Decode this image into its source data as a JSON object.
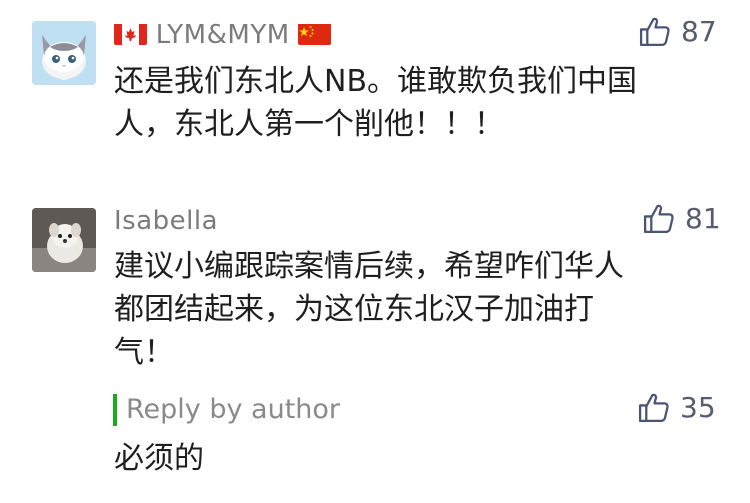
{
  "comments": [
    {
      "name": "LYM&MYM",
      "likes": "87",
      "text_lines": [
        "还是我们东北人NB。谁敢欺负我们中国",
        "人，东北人第一个削他！！！"
      ],
      "avatar_desc": "cartoon-cat-avatar"
    },
    {
      "name": "Isabella",
      "likes": "81",
      "text_lines": [
        "建议小编跟踪案情后续，希望咋们华人",
        "都团结起来，为这位东北汉子加油打",
        "气！"
      ],
      "avatar_desc": "dog-photo-avatar"
    }
  ],
  "reply": {
    "label": "Reply by author",
    "likes": "35",
    "text": "必须的"
  },
  "colors": {
    "accent_green": "#1aad19",
    "like_icon": "#4a5575"
  }
}
